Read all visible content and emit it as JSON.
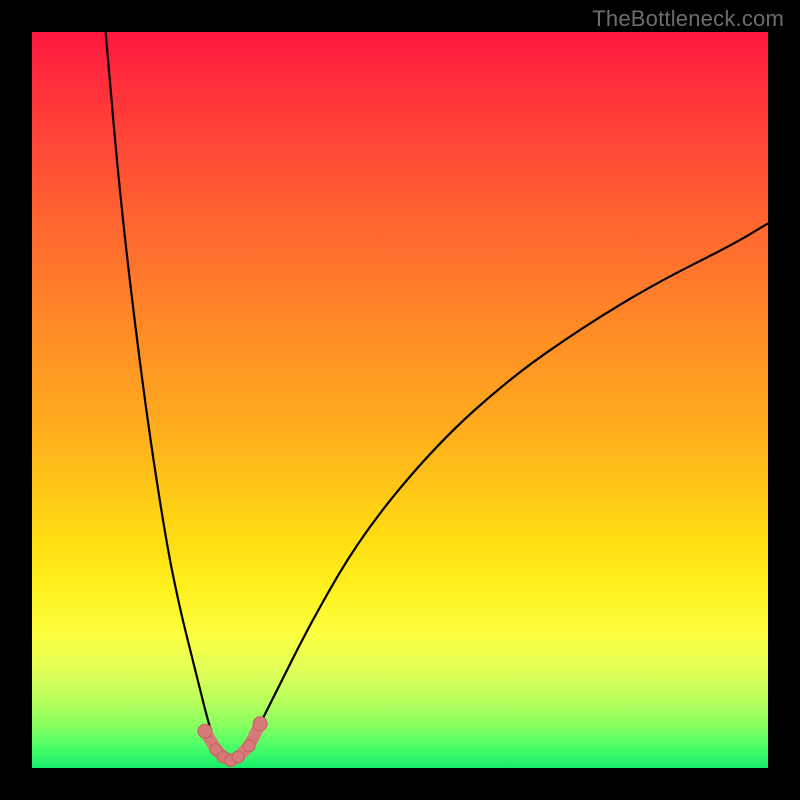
{
  "watermark": "TheBottleneck.com",
  "colors": {
    "frame": "#000000",
    "curve": "#000000",
    "marker": "#d57a78",
    "watermark_text": "#6d6d6d"
  },
  "chart_data": {
    "type": "line",
    "title": "",
    "xlabel": "",
    "ylabel": "",
    "xlim": [
      0,
      100
    ],
    "ylim": [
      0,
      100
    ],
    "notes": "U-shaped bottleneck curve. Background gradient red→green implies higher y = worse (red) and y≈0 = good (green). Minimum of curve is near x≈27 with value≈0–2. Left branch rises steeply to ~100 at x≈10. Right branch rises gradually to ~74 at x=100.",
    "series": [
      {
        "name": "bottleneck-curve",
        "x": [
          10,
          12,
          15,
          18,
          20,
          22,
          24,
          25,
          26,
          27,
          28,
          29,
          30,
          33,
          38,
          45,
          55,
          65,
          75,
          85,
          95,
          100
        ],
        "y": [
          100,
          77,
          52,
          32,
          22,
          14,
          6,
          3,
          1.5,
          0.5,
          1,
          2,
          4,
          10,
          20,
          32,
          44,
          53,
          60,
          66,
          71,
          74
        ]
      }
    ],
    "markers": {
      "comment": "Salmon dots + short arc near the curve minimum",
      "points_xy": [
        [
          23.5,
          5
        ],
        [
          25,
          2.5
        ],
        [
          26,
          1.5
        ],
        [
          27,
          1
        ],
        [
          28,
          1.5
        ],
        [
          29.5,
          3
        ],
        [
          31,
          6
        ]
      ]
    },
    "gradient_stops": [
      {
        "pos": 0.0,
        "hex": "#ff163e"
      },
      {
        "pos": 0.28,
        "hex": "#ff6b2f"
      },
      {
        "pos": 0.62,
        "hex": "#ffc617"
      },
      {
        "pos": 0.82,
        "hex": "#fbff41"
      },
      {
        "pos": 1.0,
        "hex": "#18ed6a"
      }
    ]
  }
}
